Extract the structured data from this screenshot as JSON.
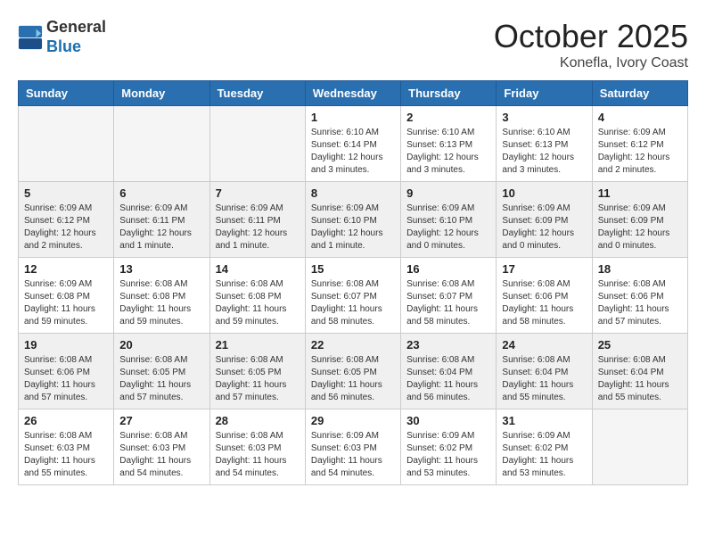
{
  "header": {
    "logo_general": "General",
    "logo_blue": "Blue",
    "month_title": "October 2025",
    "location": "Konefla, Ivory Coast"
  },
  "weekdays": [
    "Sunday",
    "Monday",
    "Tuesday",
    "Wednesday",
    "Thursday",
    "Friday",
    "Saturday"
  ],
  "weeks": [
    {
      "shaded": false,
      "days": [
        {
          "num": "",
          "info": ""
        },
        {
          "num": "",
          "info": ""
        },
        {
          "num": "",
          "info": ""
        },
        {
          "num": "1",
          "info": "Sunrise: 6:10 AM\nSunset: 6:14 PM\nDaylight: 12 hours\nand 3 minutes."
        },
        {
          "num": "2",
          "info": "Sunrise: 6:10 AM\nSunset: 6:13 PM\nDaylight: 12 hours\nand 3 minutes."
        },
        {
          "num": "3",
          "info": "Sunrise: 6:10 AM\nSunset: 6:13 PM\nDaylight: 12 hours\nand 3 minutes."
        },
        {
          "num": "4",
          "info": "Sunrise: 6:09 AM\nSunset: 6:12 PM\nDaylight: 12 hours\nand 2 minutes."
        }
      ]
    },
    {
      "shaded": true,
      "days": [
        {
          "num": "5",
          "info": "Sunrise: 6:09 AM\nSunset: 6:12 PM\nDaylight: 12 hours\nand 2 minutes."
        },
        {
          "num": "6",
          "info": "Sunrise: 6:09 AM\nSunset: 6:11 PM\nDaylight: 12 hours\nand 1 minute."
        },
        {
          "num": "7",
          "info": "Sunrise: 6:09 AM\nSunset: 6:11 PM\nDaylight: 12 hours\nand 1 minute."
        },
        {
          "num": "8",
          "info": "Sunrise: 6:09 AM\nSunset: 6:10 PM\nDaylight: 12 hours\nand 1 minute."
        },
        {
          "num": "9",
          "info": "Sunrise: 6:09 AM\nSunset: 6:10 PM\nDaylight: 12 hours\nand 0 minutes."
        },
        {
          "num": "10",
          "info": "Sunrise: 6:09 AM\nSunset: 6:09 PM\nDaylight: 12 hours\nand 0 minutes."
        },
        {
          "num": "11",
          "info": "Sunrise: 6:09 AM\nSunset: 6:09 PM\nDaylight: 12 hours\nand 0 minutes."
        }
      ]
    },
    {
      "shaded": false,
      "days": [
        {
          "num": "12",
          "info": "Sunrise: 6:09 AM\nSunset: 6:08 PM\nDaylight: 11 hours\nand 59 minutes."
        },
        {
          "num": "13",
          "info": "Sunrise: 6:08 AM\nSunset: 6:08 PM\nDaylight: 11 hours\nand 59 minutes."
        },
        {
          "num": "14",
          "info": "Sunrise: 6:08 AM\nSunset: 6:08 PM\nDaylight: 11 hours\nand 59 minutes."
        },
        {
          "num": "15",
          "info": "Sunrise: 6:08 AM\nSunset: 6:07 PM\nDaylight: 11 hours\nand 58 minutes."
        },
        {
          "num": "16",
          "info": "Sunrise: 6:08 AM\nSunset: 6:07 PM\nDaylight: 11 hours\nand 58 minutes."
        },
        {
          "num": "17",
          "info": "Sunrise: 6:08 AM\nSunset: 6:06 PM\nDaylight: 11 hours\nand 58 minutes."
        },
        {
          "num": "18",
          "info": "Sunrise: 6:08 AM\nSunset: 6:06 PM\nDaylight: 11 hours\nand 57 minutes."
        }
      ]
    },
    {
      "shaded": true,
      "days": [
        {
          "num": "19",
          "info": "Sunrise: 6:08 AM\nSunset: 6:06 PM\nDaylight: 11 hours\nand 57 minutes."
        },
        {
          "num": "20",
          "info": "Sunrise: 6:08 AM\nSunset: 6:05 PM\nDaylight: 11 hours\nand 57 minutes."
        },
        {
          "num": "21",
          "info": "Sunrise: 6:08 AM\nSunset: 6:05 PM\nDaylight: 11 hours\nand 57 minutes."
        },
        {
          "num": "22",
          "info": "Sunrise: 6:08 AM\nSunset: 6:05 PM\nDaylight: 11 hours\nand 56 minutes."
        },
        {
          "num": "23",
          "info": "Sunrise: 6:08 AM\nSunset: 6:04 PM\nDaylight: 11 hours\nand 56 minutes."
        },
        {
          "num": "24",
          "info": "Sunrise: 6:08 AM\nSunset: 6:04 PM\nDaylight: 11 hours\nand 55 minutes."
        },
        {
          "num": "25",
          "info": "Sunrise: 6:08 AM\nSunset: 6:04 PM\nDaylight: 11 hours\nand 55 minutes."
        }
      ]
    },
    {
      "shaded": false,
      "days": [
        {
          "num": "26",
          "info": "Sunrise: 6:08 AM\nSunset: 6:03 PM\nDaylight: 11 hours\nand 55 minutes."
        },
        {
          "num": "27",
          "info": "Sunrise: 6:08 AM\nSunset: 6:03 PM\nDaylight: 11 hours\nand 54 minutes."
        },
        {
          "num": "28",
          "info": "Sunrise: 6:08 AM\nSunset: 6:03 PM\nDaylight: 11 hours\nand 54 minutes."
        },
        {
          "num": "29",
          "info": "Sunrise: 6:09 AM\nSunset: 6:03 PM\nDaylight: 11 hours\nand 54 minutes."
        },
        {
          "num": "30",
          "info": "Sunrise: 6:09 AM\nSunset: 6:02 PM\nDaylight: 11 hours\nand 53 minutes."
        },
        {
          "num": "31",
          "info": "Sunrise: 6:09 AM\nSunset: 6:02 PM\nDaylight: 11 hours\nand 53 minutes."
        },
        {
          "num": "",
          "info": ""
        }
      ]
    }
  ]
}
